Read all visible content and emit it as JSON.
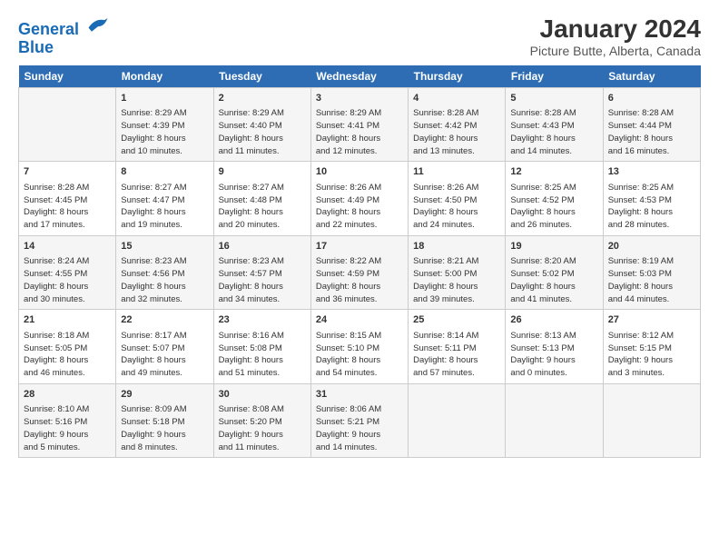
{
  "logo": {
    "line1": "General",
    "line2": "Blue"
  },
  "title": "January 2024",
  "subtitle": "Picture Butte, Alberta, Canada",
  "headers": [
    "Sunday",
    "Monday",
    "Tuesday",
    "Wednesday",
    "Thursday",
    "Friday",
    "Saturday"
  ],
  "weeks": [
    [
      {
        "day": "",
        "info": ""
      },
      {
        "day": "1",
        "info": "Sunrise: 8:29 AM\nSunset: 4:39 PM\nDaylight: 8 hours\nand 10 minutes."
      },
      {
        "day": "2",
        "info": "Sunrise: 8:29 AM\nSunset: 4:40 PM\nDaylight: 8 hours\nand 11 minutes."
      },
      {
        "day": "3",
        "info": "Sunrise: 8:29 AM\nSunset: 4:41 PM\nDaylight: 8 hours\nand 12 minutes."
      },
      {
        "day": "4",
        "info": "Sunrise: 8:28 AM\nSunset: 4:42 PM\nDaylight: 8 hours\nand 13 minutes."
      },
      {
        "day": "5",
        "info": "Sunrise: 8:28 AM\nSunset: 4:43 PM\nDaylight: 8 hours\nand 14 minutes."
      },
      {
        "day": "6",
        "info": "Sunrise: 8:28 AM\nSunset: 4:44 PM\nDaylight: 8 hours\nand 16 minutes."
      }
    ],
    [
      {
        "day": "7",
        "info": "Sunrise: 8:28 AM\nSunset: 4:45 PM\nDaylight: 8 hours\nand 17 minutes."
      },
      {
        "day": "8",
        "info": "Sunrise: 8:27 AM\nSunset: 4:47 PM\nDaylight: 8 hours\nand 19 minutes."
      },
      {
        "day": "9",
        "info": "Sunrise: 8:27 AM\nSunset: 4:48 PM\nDaylight: 8 hours\nand 20 minutes."
      },
      {
        "day": "10",
        "info": "Sunrise: 8:26 AM\nSunset: 4:49 PM\nDaylight: 8 hours\nand 22 minutes."
      },
      {
        "day": "11",
        "info": "Sunrise: 8:26 AM\nSunset: 4:50 PM\nDaylight: 8 hours\nand 24 minutes."
      },
      {
        "day": "12",
        "info": "Sunrise: 8:25 AM\nSunset: 4:52 PM\nDaylight: 8 hours\nand 26 minutes."
      },
      {
        "day": "13",
        "info": "Sunrise: 8:25 AM\nSunset: 4:53 PM\nDaylight: 8 hours\nand 28 minutes."
      }
    ],
    [
      {
        "day": "14",
        "info": "Sunrise: 8:24 AM\nSunset: 4:55 PM\nDaylight: 8 hours\nand 30 minutes."
      },
      {
        "day": "15",
        "info": "Sunrise: 8:23 AM\nSunset: 4:56 PM\nDaylight: 8 hours\nand 32 minutes."
      },
      {
        "day": "16",
        "info": "Sunrise: 8:23 AM\nSunset: 4:57 PM\nDaylight: 8 hours\nand 34 minutes."
      },
      {
        "day": "17",
        "info": "Sunrise: 8:22 AM\nSunset: 4:59 PM\nDaylight: 8 hours\nand 36 minutes."
      },
      {
        "day": "18",
        "info": "Sunrise: 8:21 AM\nSunset: 5:00 PM\nDaylight: 8 hours\nand 39 minutes."
      },
      {
        "day": "19",
        "info": "Sunrise: 8:20 AM\nSunset: 5:02 PM\nDaylight: 8 hours\nand 41 minutes."
      },
      {
        "day": "20",
        "info": "Sunrise: 8:19 AM\nSunset: 5:03 PM\nDaylight: 8 hours\nand 44 minutes."
      }
    ],
    [
      {
        "day": "21",
        "info": "Sunrise: 8:18 AM\nSunset: 5:05 PM\nDaylight: 8 hours\nand 46 minutes."
      },
      {
        "day": "22",
        "info": "Sunrise: 8:17 AM\nSunset: 5:07 PM\nDaylight: 8 hours\nand 49 minutes."
      },
      {
        "day": "23",
        "info": "Sunrise: 8:16 AM\nSunset: 5:08 PM\nDaylight: 8 hours\nand 51 minutes."
      },
      {
        "day": "24",
        "info": "Sunrise: 8:15 AM\nSunset: 5:10 PM\nDaylight: 8 hours\nand 54 minutes."
      },
      {
        "day": "25",
        "info": "Sunrise: 8:14 AM\nSunset: 5:11 PM\nDaylight: 8 hours\nand 57 minutes."
      },
      {
        "day": "26",
        "info": "Sunrise: 8:13 AM\nSunset: 5:13 PM\nDaylight: 9 hours\nand 0 minutes."
      },
      {
        "day": "27",
        "info": "Sunrise: 8:12 AM\nSunset: 5:15 PM\nDaylight: 9 hours\nand 3 minutes."
      }
    ],
    [
      {
        "day": "28",
        "info": "Sunrise: 8:10 AM\nSunset: 5:16 PM\nDaylight: 9 hours\nand 5 minutes."
      },
      {
        "day": "29",
        "info": "Sunrise: 8:09 AM\nSunset: 5:18 PM\nDaylight: 9 hours\nand 8 minutes."
      },
      {
        "day": "30",
        "info": "Sunrise: 8:08 AM\nSunset: 5:20 PM\nDaylight: 9 hours\nand 11 minutes."
      },
      {
        "day": "31",
        "info": "Sunrise: 8:06 AM\nSunset: 5:21 PM\nDaylight: 9 hours\nand 14 minutes."
      },
      {
        "day": "",
        "info": ""
      },
      {
        "day": "",
        "info": ""
      },
      {
        "day": "",
        "info": ""
      }
    ]
  ]
}
